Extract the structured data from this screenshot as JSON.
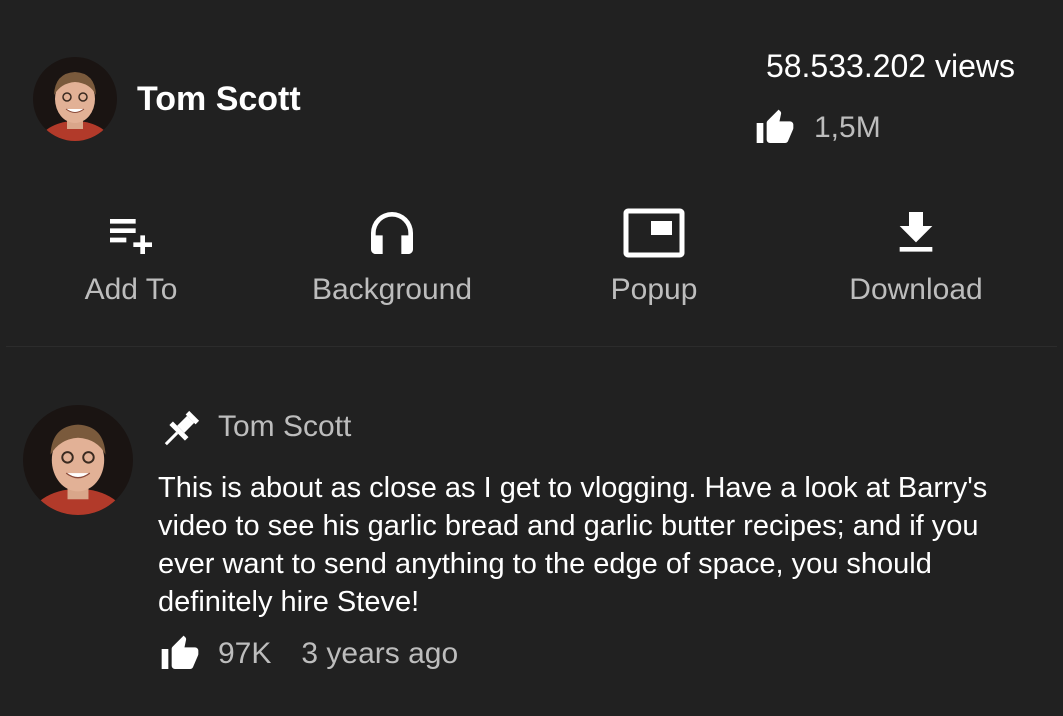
{
  "video": {
    "channel_name": "Tom Scott",
    "views": "58.533.202 views",
    "likes": "1,5M"
  },
  "actions": [
    {
      "label": "Add To",
      "icon": "playlist-add-icon"
    },
    {
      "label": "Background",
      "icon": "headphones-icon"
    },
    {
      "label": "Popup",
      "icon": "picture-in-picture-icon"
    },
    {
      "label": "Download",
      "icon": "download-icon"
    }
  ],
  "comment": {
    "pinned": true,
    "author": "Tom Scott",
    "text": "This is about as close as I get to vlogging. Have a look at Barry's video to see his garlic bread and garlic butter recipes; and if you ever want to send anything to the edge of space, you should definitely hire Steve!",
    "likes": "97K",
    "time": "3 years ago"
  },
  "colors": {
    "background": "#212121",
    "primary_text": "#ffffff",
    "secondary_text": "#bdbdbd"
  }
}
